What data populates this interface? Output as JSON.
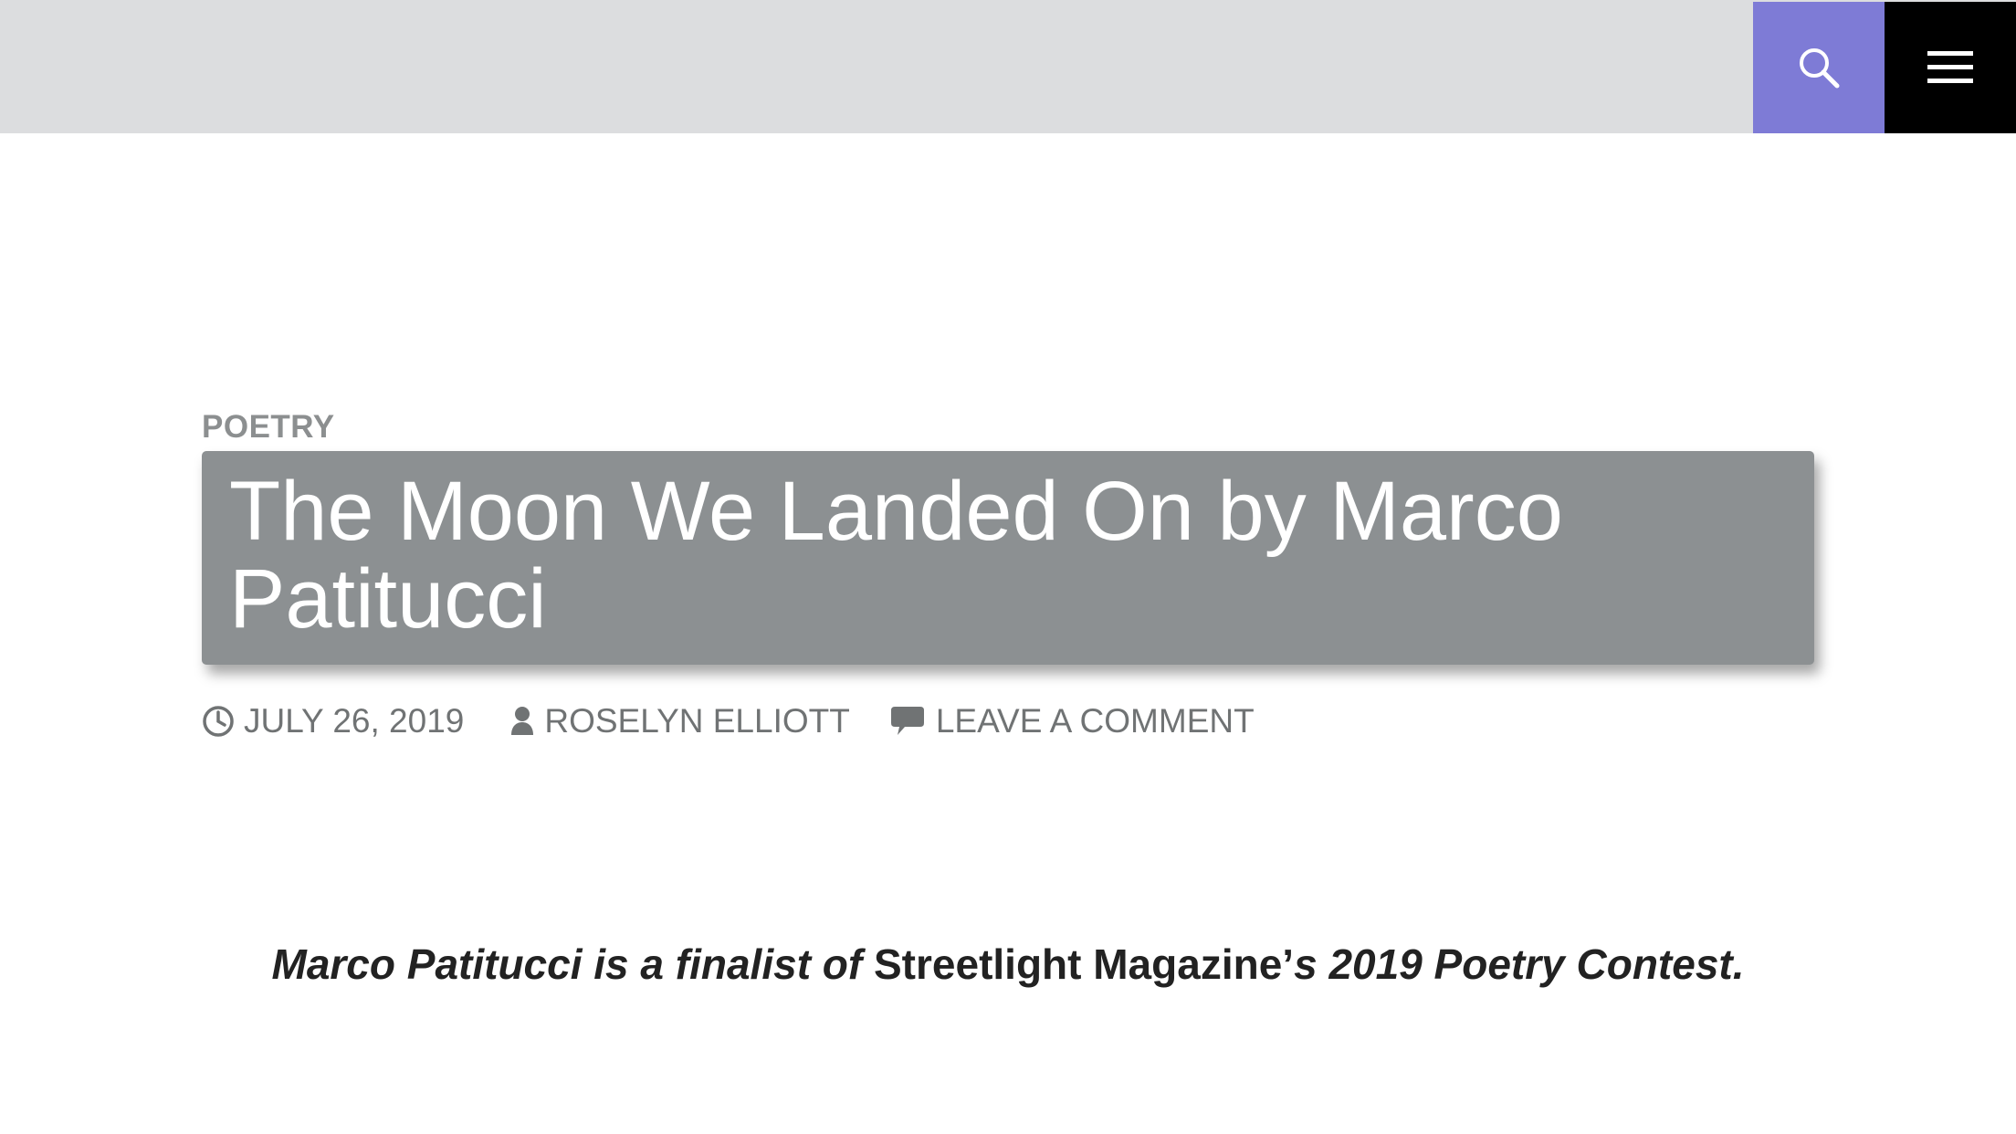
{
  "header": {
    "search_icon": "search-icon",
    "menu_icon": "hamburger-menu-icon",
    "search_bg": "#7e7bd6",
    "menu_bg": "#000000",
    "bar_bg": "#dcdddf"
  },
  "post": {
    "category": "POETRY",
    "title": "The Moon We Landed On by Marco Patitucci",
    "meta": {
      "date": "JULY 26, 2019",
      "author": "ROSELYN ELLIOTT",
      "comments": "LEAVE A COMMENT",
      "date_icon": "clock-icon",
      "author_icon": "user-icon",
      "comments_icon": "comment-icon"
    },
    "intro": {
      "part1": "Marco Patitucci is a finalist of",
      "part2": "Streetlight Magazine’",
      "part3": "s 2019 Poetry Contest."
    }
  }
}
